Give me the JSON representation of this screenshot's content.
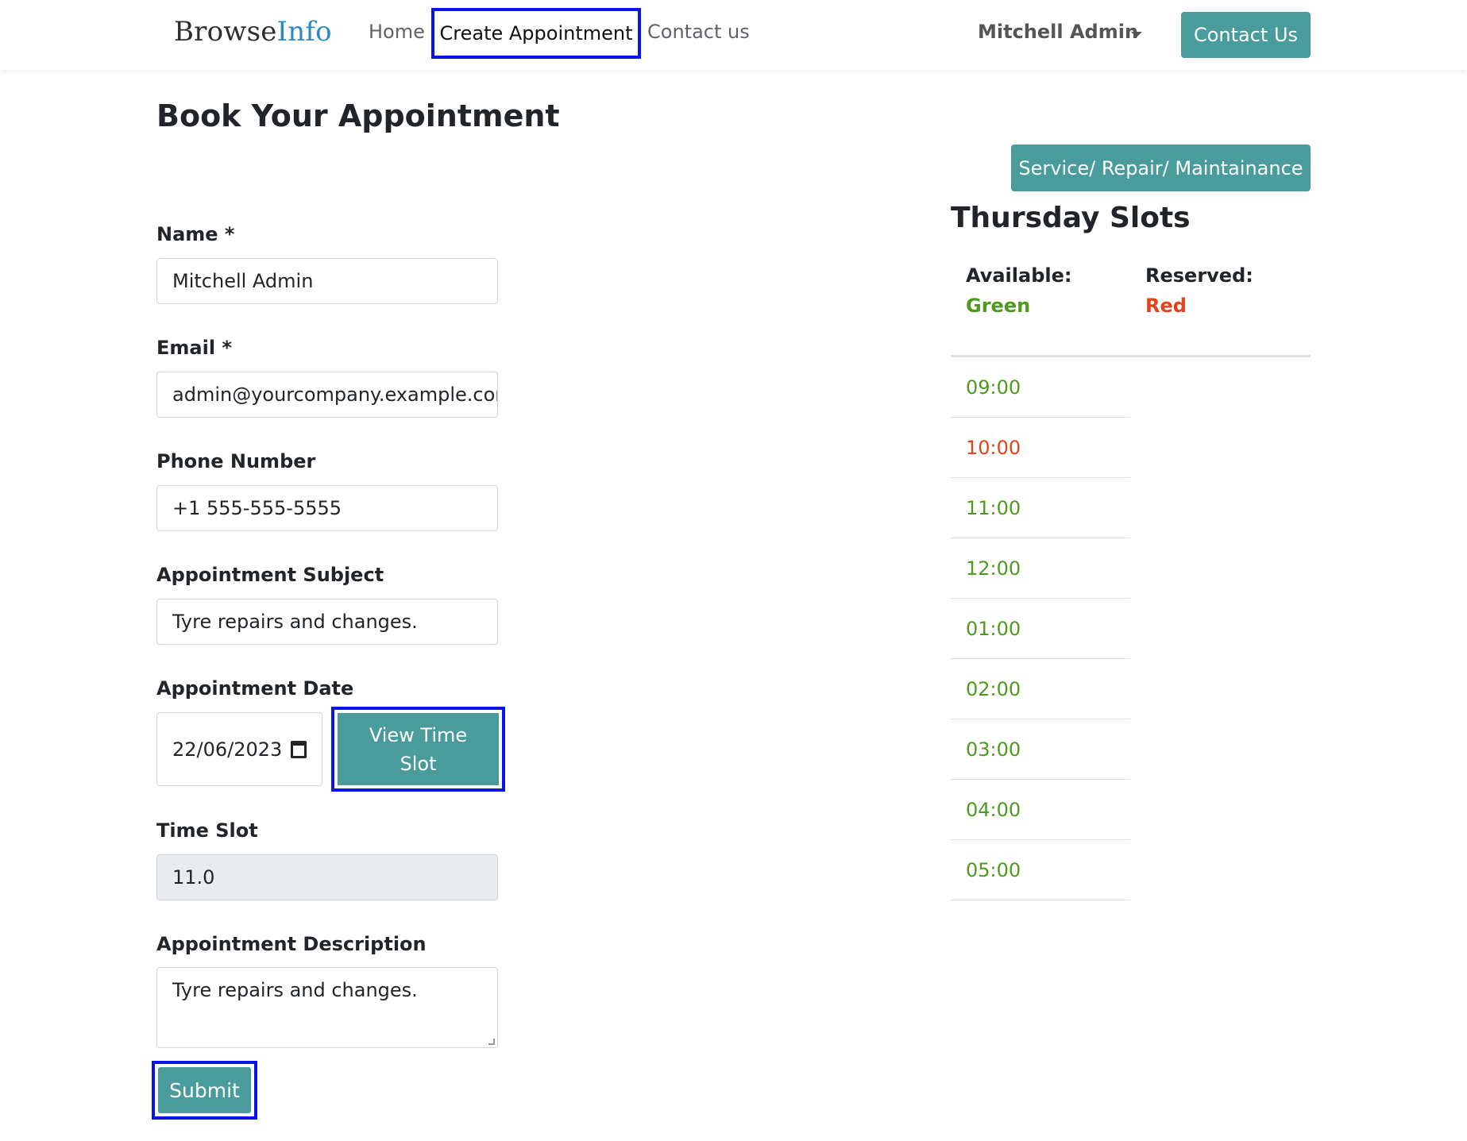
{
  "nav": {
    "logo_part1": "Browse",
    "logo_part2": "Info",
    "home": "Home",
    "create_appointment": "Create Appointment",
    "contact_link": "Contact us",
    "user": "Mitchell Admin",
    "contact_button": "Contact Us"
  },
  "page": {
    "title": "Book Your Appointment"
  },
  "form": {
    "name_label": "Name *",
    "name_value": "Mitchell Admin",
    "email_label": "Email *",
    "email_value": "admin@yourcompany.example.com",
    "phone_label": "Phone Number",
    "phone_value": "+1 555-555-5555",
    "subject_label": "Appointment Subject",
    "subject_value": "Tyre repairs and changes.",
    "date_label": "Appointment Date",
    "date_value": "22/06/2023",
    "view_slot_button": "View Time Slot",
    "timeslot_label": "Time Slot",
    "timeslot_value": "11.0",
    "description_label": "Appointment Description",
    "description_value": "Tyre repairs and changes.",
    "submit_button": "Submit"
  },
  "slots": {
    "service_button": "Service/ Repair/ Maintainance",
    "title": "Thursday Slots",
    "available_label": "Available:",
    "available_value": "Green",
    "reserved_label": "Reserved:",
    "reserved_value": "Red",
    "items": [
      {
        "time": "09:00",
        "status": "available"
      },
      {
        "time": "10:00",
        "status": "reserved"
      },
      {
        "time": "11:00",
        "status": "available"
      },
      {
        "time": "12:00",
        "status": "available"
      },
      {
        "time": "01:00",
        "status": "available"
      },
      {
        "time": "02:00",
        "status": "available"
      },
      {
        "time": "03:00",
        "status": "available"
      },
      {
        "time": "04:00",
        "status": "available"
      },
      {
        "time": "05:00",
        "status": "available"
      }
    ]
  },
  "colors": {
    "accent": "#4a9b9b",
    "available": "#4e9a1c",
    "reserved": "#e2421c",
    "highlight": "#0a14e6"
  }
}
